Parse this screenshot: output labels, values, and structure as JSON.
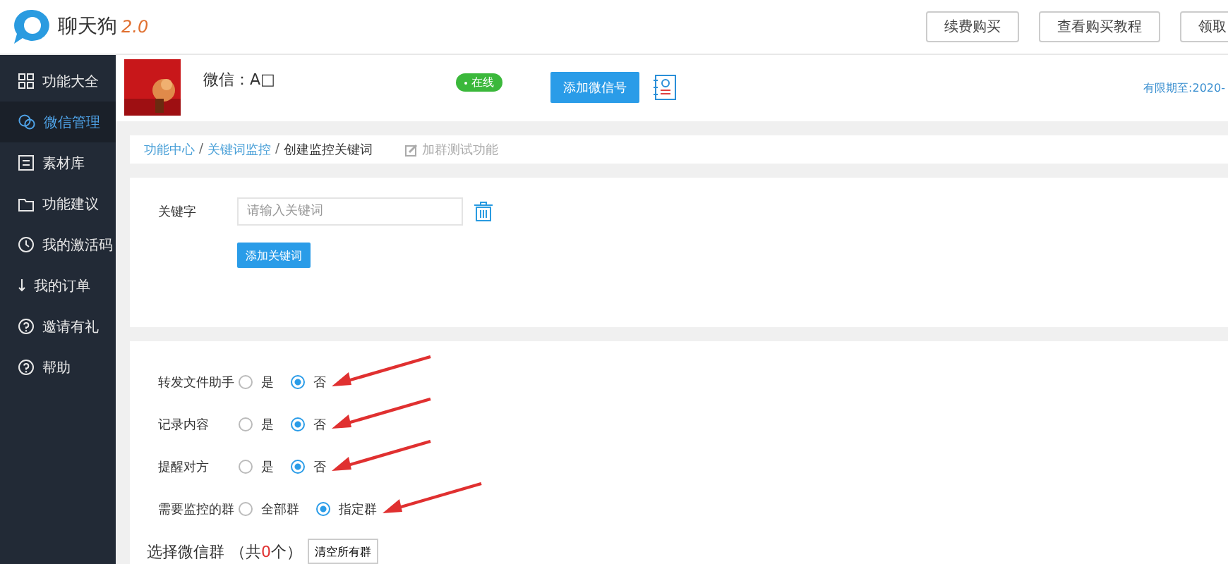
{
  "header": {
    "logo": {
      "name": "聊天狗",
      "version": "2.0"
    },
    "buttons": [
      "续费购买",
      "查看购买教程",
      "领取"
    ]
  },
  "sidebar": {
    "items": [
      {
        "label": "功能大全",
        "selected": false
      },
      {
        "label": "微信管理",
        "selected": true
      },
      {
        "label": "素材库",
        "selected": false
      },
      {
        "label": "功能建议",
        "selected": false
      },
      {
        "label": "我的激活码",
        "selected": false
      },
      {
        "label": "我的订单",
        "selected": false
      },
      {
        "label": "邀请有礼",
        "selected": false
      },
      {
        "label": "帮助",
        "selected": false
      }
    ]
  },
  "account": {
    "name": "微信：A□",
    "status": "在线",
    "add_button": "添加微信号",
    "expiry": "有限期至:2020-"
  },
  "breadcrumb": {
    "separator": "/",
    "items": [
      "功能中心",
      "关键词监控",
      "创建监控关键词"
    ],
    "test_link": "加群测试功能"
  },
  "keyword": {
    "label": "关键字",
    "placeholder": "请输入关键词",
    "add_button": "添加关键词"
  },
  "options": [
    {
      "label": "转发文件助手",
      "choices": [
        {
          "label": "是",
          "selected": false
        },
        {
          "label": "否",
          "selected": true
        }
      ]
    },
    {
      "label": "记录内容",
      "choices": [
        {
          "label": "是",
          "selected": false
        },
        {
          "label": "否",
          "selected": true
        }
      ]
    },
    {
      "label": "提醒对方",
      "choices": [
        {
          "label": "是",
          "selected": false
        },
        {
          "label": "否",
          "selected": true
        }
      ]
    },
    {
      "label": "需要监控的群",
      "choices": [
        {
          "label": "全部群",
          "selected": false
        },
        {
          "label": "指定群",
          "selected": true
        }
      ]
    }
  ],
  "groups": {
    "title": "选择微信群",
    "count_prefix": "（共",
    "count": "0",
    "count_suffix": "个）",
    "clear_button": "清空所有群"
  }
}
